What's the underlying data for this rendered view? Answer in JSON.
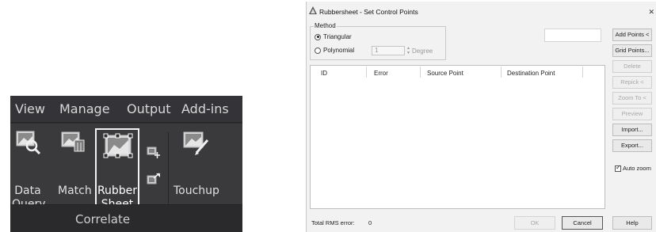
{
  "ribbon": {
    "tabs": [
      "View",
      "Manage",
      "Output",
      "Add-ins"
    ],
    "buttons": {
      "data_query": [
        "Data",
        "Query"
      ],
      "match": "Match",
      "rubber_sheet": [
        "Rubber",
        "Sheet"
      ],
      "touchup": "Touchup"
    },
    "panel_title": "Correlate",
    "colors": {
      "background": "#2d2d30",
      "text": "#e0e0e0",
      "highlight": "#ffffff"
    }
  },
  "dialog": {
    "title": "Rubbersheet - Set Control Points",
    "close_icon": "close-icon",
    "method": {
      "legend": "Method",
      "options": [
        "Triangular",
        "Polynomial"
      ],
      "selected": "Triangular",
      "degree_value": "1",
      "degree_label": "Degree"
    },
    "table": {
      "columns": [
        "ID",
        "Error",
        "Source Point",
        "Destination Point"
      ],
      "rows": []
    },
    "side_buttons": [
      {
        "label": "Add Points <",
        "enabled": true
      },
      {
        "label": "Grid Points...",
        "enabled": true
      },
      {
        "label": "Delete",
        "enabled": false
      },
      {
        "label": "Repick <",
        "enabled": false
      },
      {
        "label": "Zoom To <",
        "enabled": false
      },
      {
        "label": "Preview",
        "enabled": false
      },
      {
        "label": "Import...",
        "enabled": true
      },
      {
        "label": "Export...",
        "enabled": true
      }
    ],
    "auto_zoom": {
      "label": "Auto zoom",
      "checked": true
    },
    "rms": {
      "label": "Total RMS error:",
      "value": "0"
    },
    "footer": {
      "ok": "OK",
      "cancel": "Cancel",
      "help": "Help"
    }
  }
}
